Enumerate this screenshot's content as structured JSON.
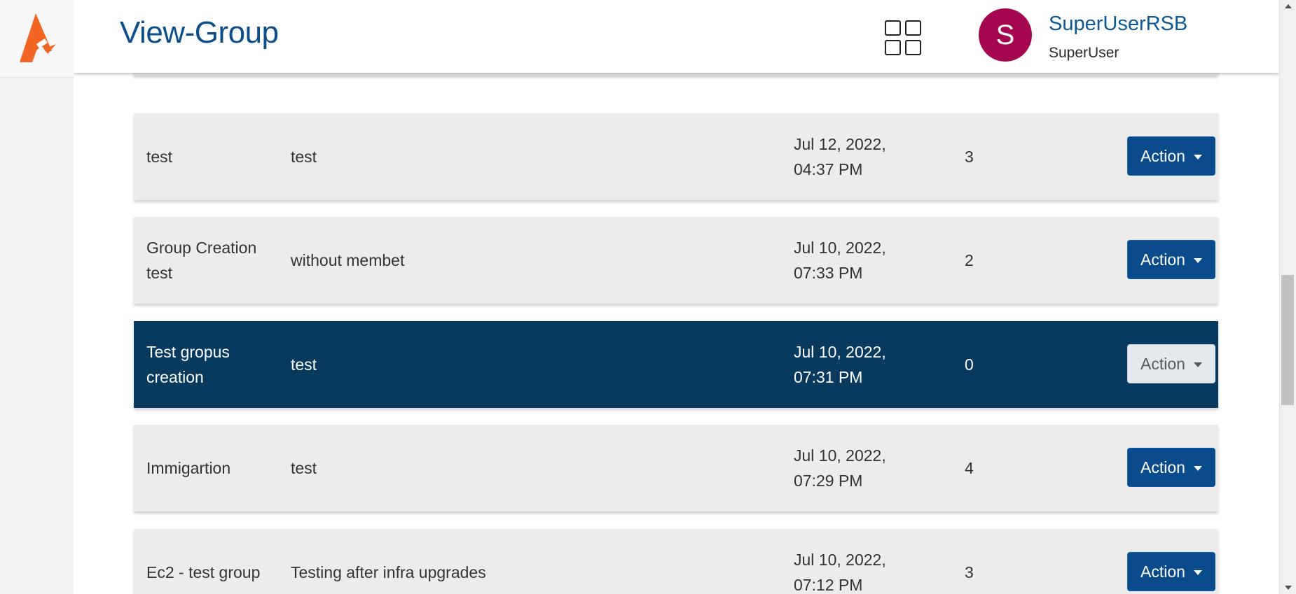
{
  "header": {
    "title": "View-Group",
    "apps_icon": "apps-grid-icon",
    "avatar_initial": "S",
    "user_name": "SuperUserRSB",
    "user_role": "SuperUser"
  },
  "logo": {
    "icon": "brand-logo-icon",
    "color": "#f26522"
  },
  "rows": [
    {
      "name": "test",
      "description": "test",
      "date": "Jul 12, 2022, 04:37 PM",
      "members": "3",
      "action_label": "Action",
      "selected": false
    },
    {
      "name": "Group Creation test",
      "description": "without membet",
      "date": "Jul 10, 2022, 07:33 PM",
      "members": "2",
      "action_label": "Action",
      "selected": false
    },
    {
      "name": "Test gropus creation",
      "description": "test",
      "date": "Jul 10, 2022, 07:31 PM",
      "members": "0",
      "action_label": "Action",
      "selected": true
    },
    {
      "name": "Immigartion",
      "description": "test",
      "date": "Jul 10, 2022, 07:29 PM",
      "members": "4",
      "action_label": "Action",
      "selected": false
    },
    {
      "name": "Ec2 - test group",
      "description": "Testing after infra upgrades",
      "date": "Jul 10, 2022, 07:12 PM",
      "members": "3",
      "action_label": "Action",
      "selected": false
    }
  ],
  "colors": {
    "accent": "#0a4b8c",
    "selected_row": "#073a5e",
    "avatar": "#a4064f",
    "row_bg": "#ececec"
  }
}
